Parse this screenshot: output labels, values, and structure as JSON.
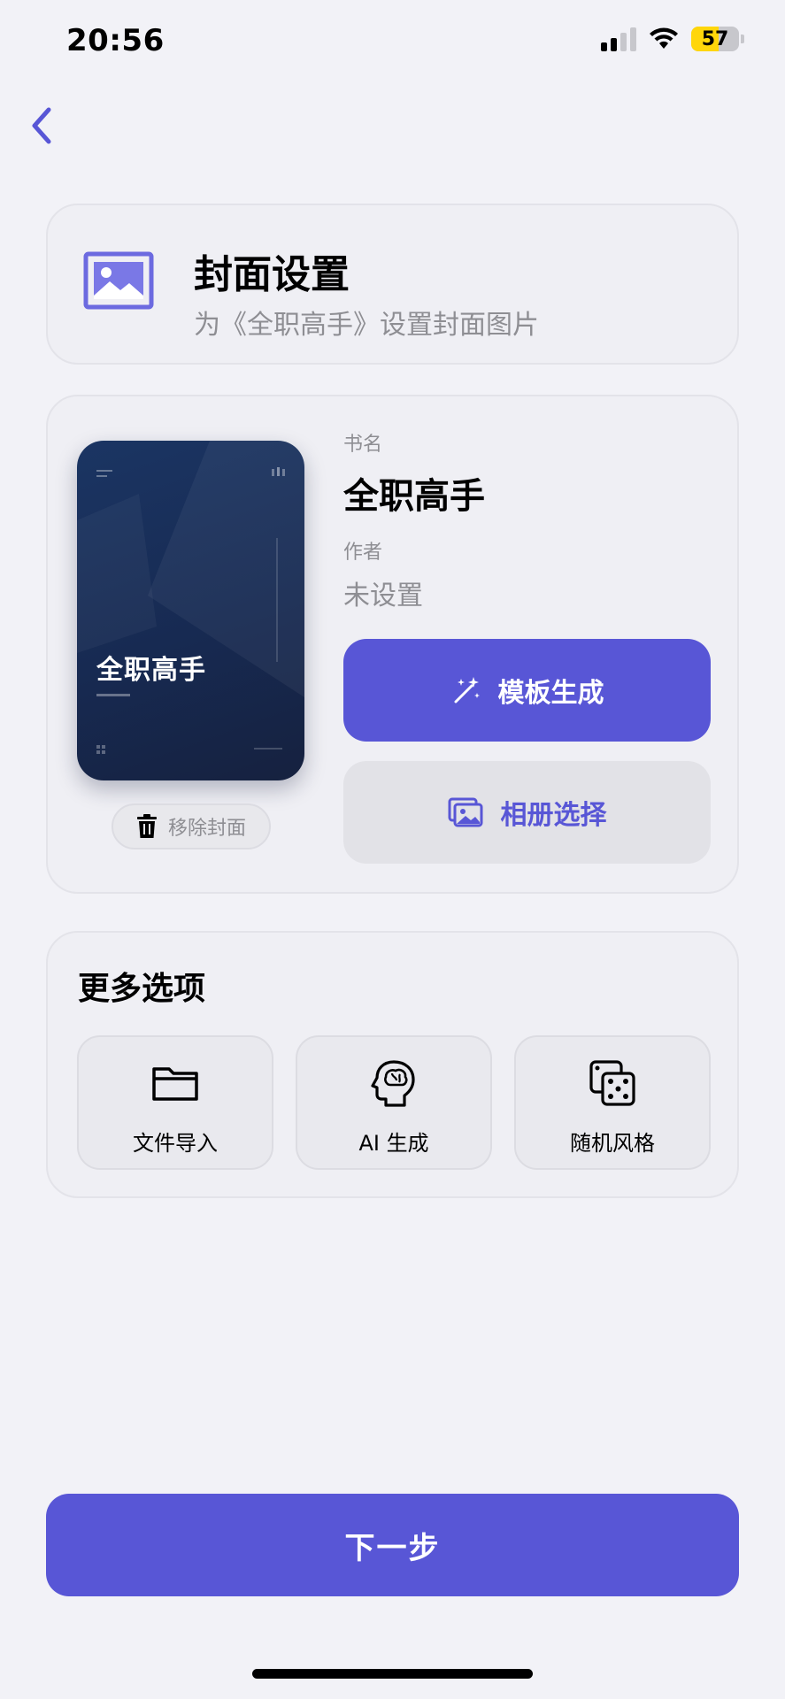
{
  "status_bar": {
    "time": "20:56",
    "battery_percent": "57",
    "battery_level": 0.57
  },
  "header": {
    "title": "封面设置",
    "subtitle": "为《全职高手》设置封面图片"
  },
  "cover": {
    "thumbnail_title": "全职高手",
    "remove_label": "移除封面"
  },
  "book": {
    "name_label": "书名",
    "name_value": "全职高手",
    "author_label": "作者",
    "author_value": "未设置"
  },
  "actions": {
    "template_label": "模板生成",
    "album_label": "相册选择"
  },
  "more": {
    "title": "更多选项",
    "options": [
      {
        "label": "文件导入",
        "icon": "folder-icon"
      },
      {
        "label": "AI 生成",
        "icon": "brain-icon"
      },
      {
        "label": "随机风格",
        "icon": "dice-icon"
      }
    ]
  },
  "footer": {
    "next_label": "下一步"
  },
  "colors": {
    "accent": "#5856d6",
    "background": "#f2f2f7",
    "cover_dark": "#172a52",
    "battery": "#ffd60a"
  }
}
